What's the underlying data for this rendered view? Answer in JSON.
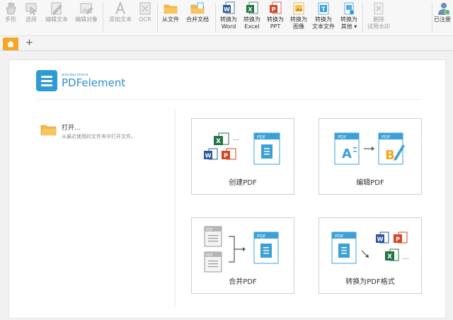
{
  "toolbar": {
    "hand": "手形",
    "select": "选择",
    "edit_text": "编辑文本",
    "edit_object": "编辑对象",
    "add_text": "添加文本",
    "ocr": "OCR",
    "from_file": "从文件",
    "combine": "合并文档",
    "to_word_1": "转换为",
    "to_word_2": "Word",
    "to_excel_1": "转换为",
    "to_excel_2": "Excel",
    "to_ppt_1": "转换为",
    "to_ppt_2": "PPT",
    "to_image_1": "转换为",
    "to_image_2": "图像",
    "to_text_1": "转换为",
    "to_text_2": "文本文件",
    "to_other_1": "转换为",
    "to_other_2": "其他",
    "remove_wm_1": "删除",
    "remove_wm_2": "试用水印",
    "register": "已注册"
  },
  "logo": {
    "brand": "wondershare",
    "name": "PDFelement"
  },
  "open": {
    "title": "打开...",
    "subtitle": "从最近使用的文件夹中打开文件。"
  },
  "cards": {
    "create": "创建PDF",
    "edit": "编辑PDF",
    "combine": "合并PDF",
    "convert": "转换为PDF格式"
  },
  "colors": {
    "accent": "#2e9bd6",
    "tab": "#f5a623",
    "word": "#2b579a",
    "excel": "#217346",
    "ppt": "#d24726"
  }
}
